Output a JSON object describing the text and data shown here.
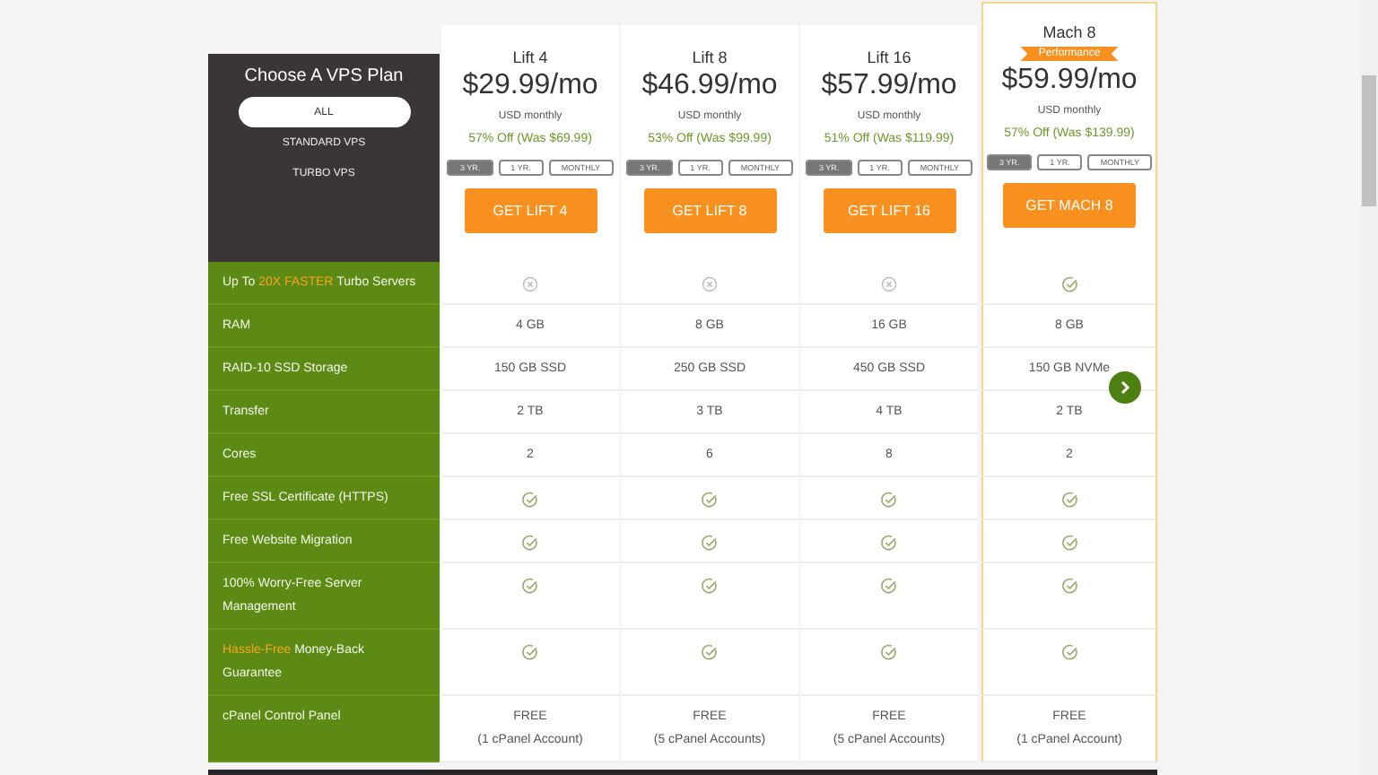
{
  "sidebar": {
    "title": "Choose A VPS Plan",
    "filters": [
      {
        "label": "ALL",
        "selected": true
      },
      {
        "label": "STANDARD VPS",
        "selected": false
      },
      {
        "label": "TURBO VPS",
        "selected": false
      }
    ]
  },
  "plans": [
    {
      "name": "Lift 4",
      "featured": false,
      "price": "$29.99/mo",
      "period": "USD monthly",
      "discount": "57% Off (Was $69.99)",
      "terms": [
        {
          "label": "3 YR.",
          "selected": true
        },
        {
          "label": "1 YR.",
          "selected": false
        },
        {
          "label": "MONTHLY",
          "selected": false
        }
      ],
      "button": "GET LIFT 4"
    },
    {
      "name": "Lift 8",
      "featured": false,
      "price": "$46.99/mo",
      "period": "USD monthly",
      "discount": "53% Off (Was $99.99)",
      "terms": [
        {
          "label": "3 YR.",
          "selected": true
        },
        {
          "label": "1 YR.",
          "selected": false
        },
        {
          "label": "MONTHLY",
          "selected": false
        }
      ],
      "button": "GET LIFT 8"
    },
    {
      "name": "Lift 16",
      "featured": false,
      "price": "$57.99/mo",
      "period": "USD monthly",
      "discount": "51% Off (Was $119.99)",
      "terms": [
        {
          "label": "3 YR.",
          "selected": true
        },
        {
          "label": "1 YR.",
          "selected": false
        },
        {
          "label": "MONTHLY",
          "selected": false
        }
      ],
      "button": "GET LIFT 16"
    },
    {
      "name": "Mach 8",
      "featured": true,
      "badge": "Performance",
      "price": "$59.99/mo",
      "period": "USD monthly",
      "discount": "57% Off (Was $139.99)",
      "terms": [
        {
          "label": "3 YR.",
          "selected": true
        },
        {
          "label": "1 YR.",
          "selected": false
        },
        {
          "label": "MONTHLY",
          "selected": false
        }
      ],
      "button": "GET MACH 8"
    }
  ],
  "features": [
    {
      "label": "Up To **20X FASTER** Turbo Servers",
      "values": [
        {
          "kind": "cross"
        },
        {
          "kind": "cross"
        },
        {
          "kind": "cross"
        },
        {
          "kind": "check"
        }
      ]
    },
    {
      "label": "RAM",
      "values": [
        {
          "kind": "text",
          "lines": [
            "4 GB"
          ]
        },
        {
          "kind": "text",
          "lines": [
            "8 GB"
          ]
        },
        {
          "kind": "text",
          "lines": [
            "16 GB"
          ]
        },
        {
          "kind": "text",
          "lines": [
            "8 GB"
          ]
        }
      ]
    },
    {
      "label": "RAID-10 SSD Storage",
      "values": [
        {
          "kind": "text",
          "lines": [
            "150 GB SSD"
          ]
        },
        {
          "kind": "text",
          "lines": [
            "250 GB SSD"
          ]
        },
        {
          "kind": "text",
          "lines": [
            "450 GB SSD"
          ]
        },
        {
          "kind": "text",
          "lines": [
            "150 GB NVMe"
          ]
        }
      ]
    },
    {
      "label": "Transfer",
      "values": [
        {
          "kind": "text",
          "lines": [
            "2 TB"
          ]
        },
        {
          "kind": "text",
          "lines": [
            "3 TB"
          ]
        },
        {
          "kind": "text",
          "lines": [
            "4 TB"
          ]
        },
        {
          "kind": "text",
          "lines": [
            "2 TB"
          ]
        }
      ]
    },
    {
      "label": "Cores",
      "values": [
        {
          "kind": "text",
          "lines": [
            "2"
          ]
        },
        {
          "kind": "text",
          "lines": [
            "6"
          ]
        },
        {
          "kind": "text",
          "lines": [
            "8"
          ]
        },
        {
          "kind": "text",
          "lines": [
            "2"
          ]
        }
      ]
    },
    {
      "label": "Free SSL Certificate (HTTPS)",
      "values": [
        {
          "kind": "check"
        },
        {
          "kind": "check"
        },
        {
          "kind": "check"
        },
        {
          "kind": "check"
        }
      ]
    },
    {
      "label": "Free Website Migration",
      "values": [
        {
          "kind": "check"
        },
        {
          "kind": "check"
        },
        {
          "kind": "check"
        },
        {
          "kind": "check"
        }
      ]
    },
    {
      "label": "100% Worry-Free Server Management",
      "values": [
        {
          "kind": "check"
        },
        {
          "kind": "check"
        },
        {
          "kind": "check"
        },
        {
          "kind": "check"
        }
      ]
    },
    {
      "label": "**Hassle-Free** Money-Back Guarantee",
      "values": [
        {
          "kind": "check"
        },
        {
          "kind": "check"
        },
        {
          "kind": "check"
        },
        {
          "kind": "check"
        }
      ]
    },
    {
      "label": "cPanel Control Panel",
      "values": [
        {
          "kind": "text",
          "lines": [
            "FREE",
            "(1 cPanel Account)"
          ]
        },
        {
          "kind": "text",
          "lines": [
            "FREE",
            "(5 cPanel Accounts)"
          ]
        },
        {
          "kind": "text",
          "lines": [
            "FREE",
            "(5 cPanel Accounts)"
          ]
        },
        {
          "kind": "text",
          "lines": [
            "FREE",
            "(1 cPanel Account)"
          ]
        }
      ]
    }
  ]
}
